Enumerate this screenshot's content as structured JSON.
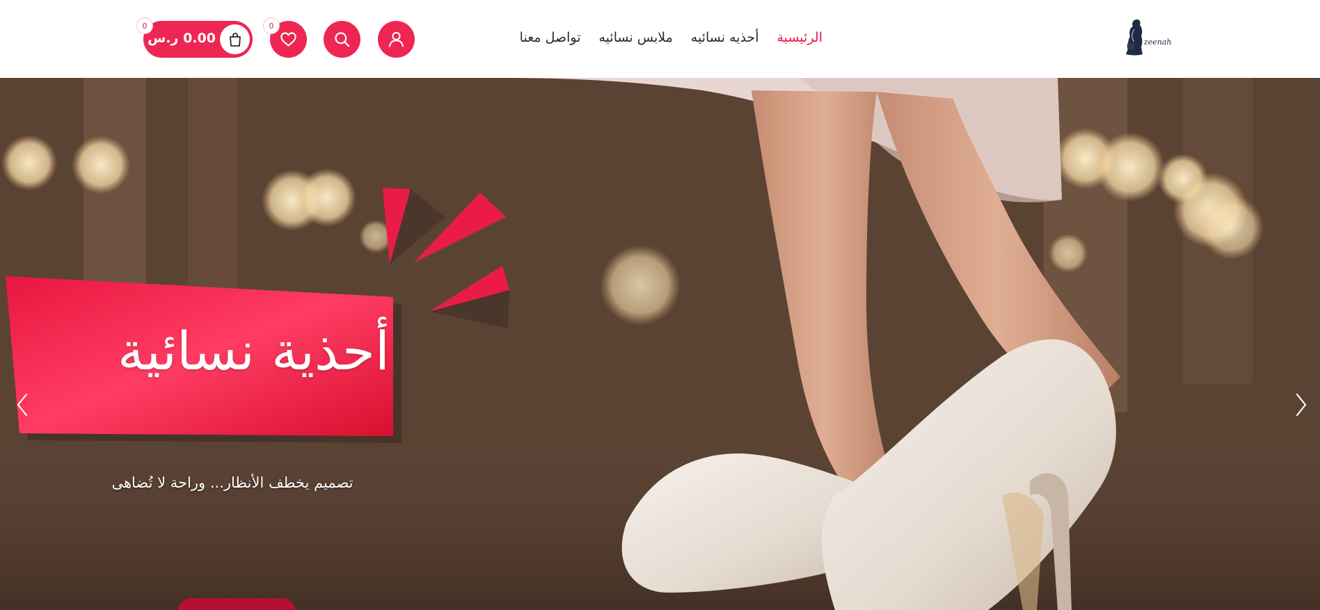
{
  "header": {
    "logo_text": "zeenah",
    "nav": [
      {
        "label": "الرئيسية",
        "active": true
      },
      {
        "label": "أحذيه نسائيه",
        "active": false
      },
      {
        "label": "ملابس نسائيه",
        "active": false
      },
      {
        "label": "تواصل معنا",
        "active": false
      }
    ],
    "icons": {
      "account": "user-icon",
      "search": "search-icon",
      "wishlist": "heart-icon",
      "cart": "shopping-bag-icon"
    },
    "wishlist_count": "0",
    "cart_count": "0",
    "cart_total": "0.00 ر.س"
  },
  "hero": {
    "title": "أحذية نسائية",
    "subtitle": "تصميم يخطف الأنظار... وراحة لا تُضاهى",
    "prev_icon": "chevron-left-icon",
    "next_icon": "chevron-right-icon"
  },
  "colors": {
    "accent": "#ee2653",
    "active_nav": "#e8174a",
    "banner_red": "#e8173f",
    "cta": "#b5102f"
  }
}
